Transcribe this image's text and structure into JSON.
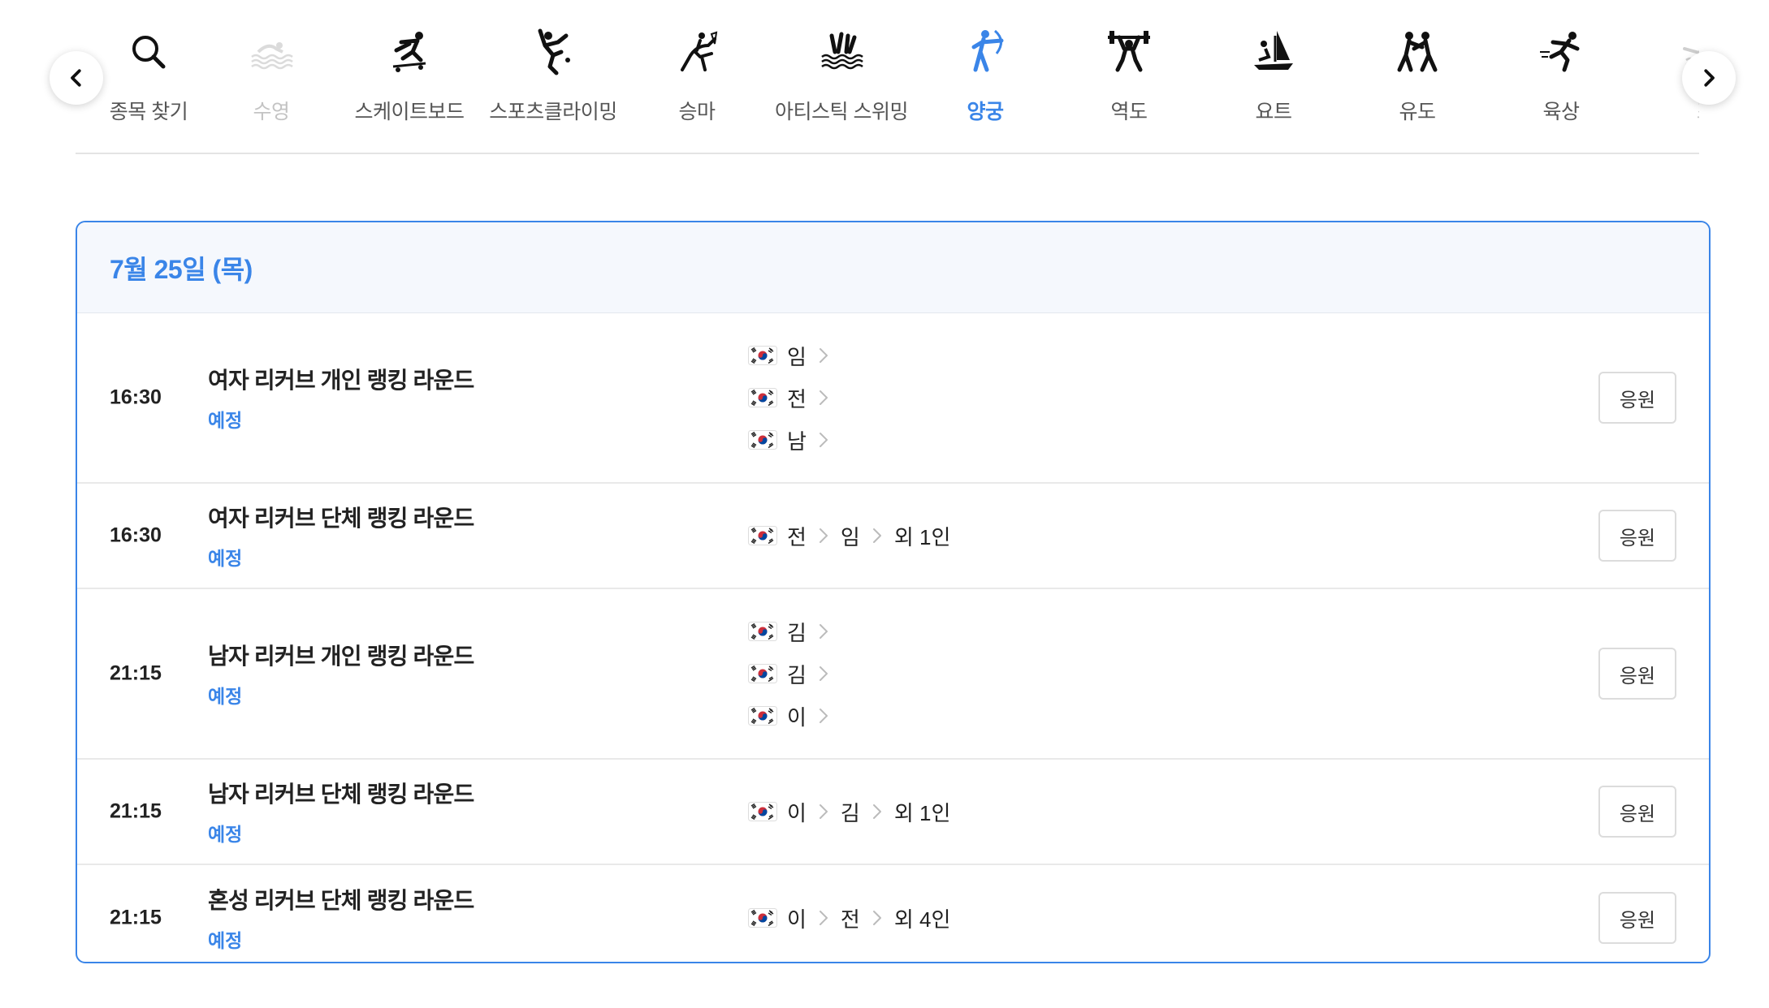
{
  "nav": {
    "sports": [
      {
        "label": "종목 찾기",
        "icon": "search-icon"
      },
      {
        "label": "수영",
        "icon": "swimming-icon"
      },
      {
        "label": "스케이트보드",
        "icon": "skateboarding-icon"
      },
      {
        "label": "스포츠클라이밍",
        "icon": "sport-climbing-icon"
      },
      {
        "label": "승마",
        "icon": "equestrian-icon"
      },
      {
        "label": "아티스틱 스위밍",
        "icon": "artistic-swimming-icon"
      },
      {
        "label": "양궁",
        "icon": "archery-icon",
        "active": true
      },
      {
        "label": "역도",
        "icon": "weightlifting-icon"
      },
      {
        "label": "요트",
        "icon": "sailing-icon"
      },
      {
        "label": "유도",
        "icon": "judo-icon"
      },
      {
        "label": "육상",
        "icon": "athletics-icon"
      },
      {
        "label": "조",
        "icon": "rowing-icon"
      }
    ],
    "prev_icon": "chevron-left-icon",
    "next_icon": "chevron-right-icon"
  },
  "schedule": {
    "date": "7월 25일 (목)",
    "events": [
      {
        "time": "16:30",
        "name": "여자 리커브 개인 랭킹 라운드",
        "status": "예정",
        "athlete_lines": [
          [
            "임"
          ],
          [
            "전"
          ],
          [
            "남"
          ]
        ],
        "more": "",
        "cheer": "응원"
      },
      {
        "time": "16:30",
        "name": "여자 리커브 단체 랭킹 라운드",
        "status": "예정",
        "athlete_lines": [
          [
            "전",
            "임"
          ]
        ],
        "more": "외 1인",
        "cheer": "응원"
      },
      {
        "time": "21:15",
        "name": "남자 리커브 개인 랭킹 라운드",
        "status": "예정",
        "athlete_lines": [
          [
            "김"
          ],
          [
            "김"
          ],
          [
            "이"
          ]
        ],
        "more": "",
        "cheer": "응원"
      },
      {
        "time": "21:15",
        "name": "남자 리커브 단체 랭킹 라운드",
        "status": "예정",
        "athlete_lines": [
          [
            "이",
            "김"
          ]
        ],
        "more": "외 1인",
        "cheer": "응원"
      },
      {
        "time": "21:15",
        "name": "혼성 리커브 단체 랭킹 라운드",
        "status": "예정",
        "athlete_lines": [
          [
            "이",
            "전"
          ]
        ],
        "more": "외 4인",
        "cheer": "응원"
      }
    ]
  },
  "colors": {
    "accent": "#3a85e8",
    "header_bg": "#f5f8fd"
  },
  "flag": "south-korea-flag-icon"
}
